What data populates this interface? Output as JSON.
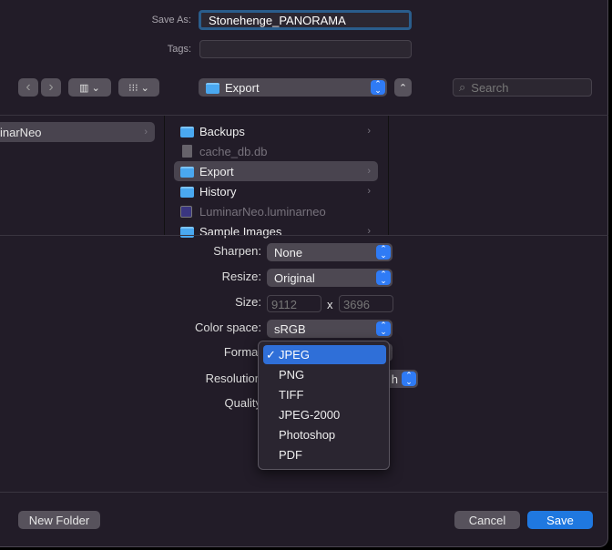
{
  "save_as": {
    "label": "Save As:",
    "value": "Stonehenge_PANORAMA"
  },
  "tags": {
    "label": "Tags:",
    "value": ""
  },
  "toolbar": {
    "back": "‹",
    "forward": "›",
    "location": "Export",
    "search_placeholder": "Search"
  },
  "sidebar": {
    "selected": "inarNeo"
  },
  "files": [
    {
      "name": "Backups",
      "type": "folder",
      "dim": false,
      "chevron": true
    },
    {
      "name": "cache_db.db",
      "type": "file",
      "dim": true,
      "chevron": false
    },
    {
      "name": "Export",
      "type": "folder",
      "dim": false,
      "chevron": true,
      "selected": true
    },
    {
      "name": "History",
      "type": "folder",
      "dim": false,
      "chevron": true
    },
    {
      "name": "LuminarNeo.luminarneo",
      "type": "app",
      "dim": true,
      "chevron": false
    },
    {
      "name": "Sample Images",
      "type": "folder",
      "dim": false,
      "chevron": true
    }
  ],
  "options": {
    "sharpen": {
      "label": "Sharpen:",
      "value": "None"
    },
    "resize": {
      "label": "Resize:",
      "value": "Original"
    },
    "size": {
      "label": "Size:",
      "width": "9112",
      "x": "x",
      "height": "3696"
    },
    "color_space": {
      "label": "Color space:",
      "value": "sRGB"
    },
    "format": {
      "label": "Format"
    },
    "resolution": {
      "label": "Resolution",
      "value_visible": "h"
    },
    "quality": {
      "label": "Quality"
    }
  },
  "format_menu": {
    "checkmark": "✓",
    "items": [
      "JPEG",
      "PNG",
      "TIFF",
      "JPEG-2000",
      "Photoshop",
      "PDF"
    ],
    "selected": "JPEG"
  },
  "footer": {
    "new_folder": "New Folder",
    "cancel": "Cancel",
    "save": "Save"
  },
  "colors": {
    "accent": "#2f7bf5",
    "background": "#221c28"
  }
}
